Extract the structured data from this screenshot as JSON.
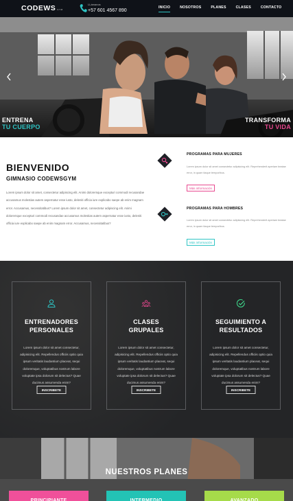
{
  "header": {
    "logo_main": "CODEWS",
    "logo_small": "GYM",
    "phone_label": "LLámanos",
    "phone_number": "+57 601 4567 890",
    "nav": [
      "INICIO",
      "NOSOTROS",
      "PLANES",
      "CLASES",
      "CONTACTO"
    ],
    "active_nav": "INICIO",
    "accent_color": "#2ec4c4"
  },
  "hero": {
    "left_title": "ENTRENA",
    "left_subtitle": "TU CUERPO",
    "right_title": "TRANSFORMA",
    "right_subtitle": "TU VIDA",
    "prev_icon": "chevron-left-icon",
    "next_icon": "chevron-right-icon"
  },
  "welcome": {
    "title": "BIENVENIDO",
    "subtitle": "GIMNASIO CODEWSGYM",
    "paragraph": "Lorem ipsum dolor sit amet, consectetur adipiscing elit. Animi doloremque excepturi commodi recusandae accusamus molestias autem aspernatur esse iusto, deleniti officia iure explicabo saepe ab enim magnam error. Accusamus, necessitatibus? Lorem ipsum dolor sit amet, consectetur adipiscing elit. Animi doloremque excepturi commodi recusandae accusamus molestias autem aspernatur esse iusto, deleniti officia iure explicabo saepe ab enim magnam error. Accusamus, necessitatibus?"
  },
  "programs": [
    {
      "title": "PROGRAMAS PARA MUJERES",
      "text": "Lorem ipsum dolor sit amet consectetur adipisicing elit. Reprehenderit aperiam beatae error, in quam itaque temporibus.",
      "button": "Más información",
      "icon": "female-symbol-icon",
      "color": "#e8488f"
    },
    {
      "title": "PROGRAMAS PARA HOMBRES",
      "text": "Lorem ipsum dolor sit amet consectetur adipisicing elit. Reprehenderit aperiam beatae error, in quam itaque temporibus.",
      "button": "Más información",
      "icon": "male-symbol-icon",
      "color": "#2ec4c4"
    }
  ],
  "services": [
    {
      "title_line1": "ENTRENADORES",
      "title_line2": "PERSONALES",
      "text": "Lorem ipsum dolor sit amet consectetur, adipisicing elit. Repellendus officiis optio quia ipsum veritatis laudantium placeat, sequi doloremque, voluptatibus nostrum labore voluptate ipsa dolorum sit delectus? Quae ducimus assumenda enim?",
      "button": "INSCRIBETE",
      "icon": "user-icon",
      "icon_color": "#2ec4c4"
    },
    {
      "title_line1": "CLASES",
      "title_line2": "GRUPALES",
      "text": "Lorem ipsum dolor sit amet consectetur, adipisicing elit. Repellendus officiis optio quia ipsum veritatis laudantium placeat, sequi doloremque, voluptatibus nostrum labore voluptate ipsa dolorum sit delectus? Quae ducimus assumenda enim?",
      "button": "INSCRIBETE",
      "icon": "group-icon",
      "icon_color": "#e8488f"
    },
    {
      "title_line1": "SEGUIMIENTO A",
      "title_line2": "RESULTADOS",
      "text": "Lorem ipsum dolor sit amet consectetur, adipisicing elit. Repellendus officiis optio quia ipsum veritatis laudantium placeat, sequi doloremque, voluptatibus nostrum labore voluptate ipsa dolorum sit delectus? Quae ducimus assumenda enim?",
      "button": "INSCRIBETE",
      "icon": "check-circle-icon",
      "icon_color": "#3ed68a"
    }
  ],
  "plans": {
    "title": "NUESTROS PLANES",
    "cards": [
      {
        "label": "PRINCIPIANTE",
        "color": "#f0509a"
      },
      {
        "label": "INTERMEDIO",
        "color": "#23c3b5"
      },
      {
        "label": "AVANZADO",
        "color": "#a6db4a"
      }
    ]
  }
}
